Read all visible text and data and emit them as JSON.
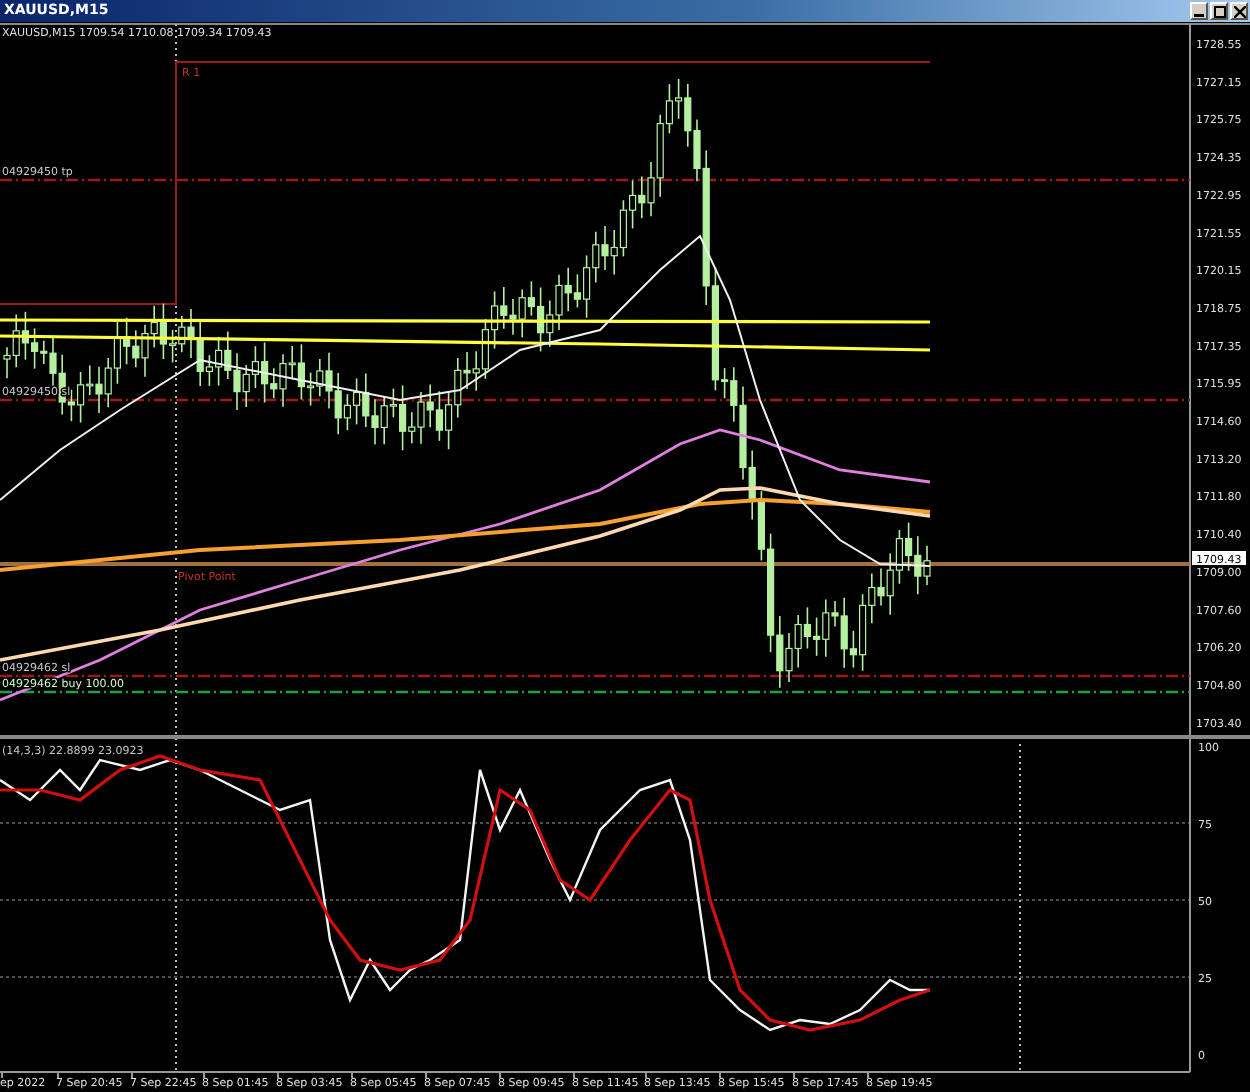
{
  "window": {
    "title": "XAUUSD,M15"
  },
  "chart": {
    "header": "XAUUSD,M15  1709.54 1710.08 1709.34 1709.43",
    "price_labels": [
      "1728.55",
      "1727.15",
      "1725.75",
      "1724.35",
      "1722.95",
      "1721.55",
      "1720.15",
      "1718.75",
      "1717.35",
      "1715.95",
      "1714.60",
      "1713.20",
      "1711.80",
      "1710.40",
      "1709.00",
      "1707.60",
      "1706.20",
      "1704.80",
      "1703.40"
    ],
    "current_price": "1709.43",
    "levels": [
      {
        "label": "R 1",
        "kind": "resistance"
      },
      {
        "label": "04929450 tp",
        "kind": "order"
      },
      {
        "label": "04929450 sl",
        "kind": "order"
      },
      {
        "label": "Pivot Point",
        "kind": "pivot"
      },
      {
        "label": "04929462 sl",
        "kind": "order"
      },
      {
        "label": "04929462 buy 100.00",
        "kind": "entry"
      }
    ]
  },
  "indicator": {
    "label": "(14,3,3) 22.8899 23.0923",
    "scale": [
      "100",
      "75",
      "50",
      "25",
      "0"
    ]
  },
  "time_axis": [
    "ep 2022",
    "7 Sep 20:45",
    "7 Sep 22:45",
    "8 Sep 01:45",
    "8 Sep 03:45",
    "8 Sep 05:45",
    "8 Sep 07:45",
    "8 Sep 09:45",
    "8 Sep 11:45",
    "8 Sep 13:45",
    "8 Sep 15:45",
    "8 Sep 17:45",
    "8 Sep 19:45"
  ]
}
